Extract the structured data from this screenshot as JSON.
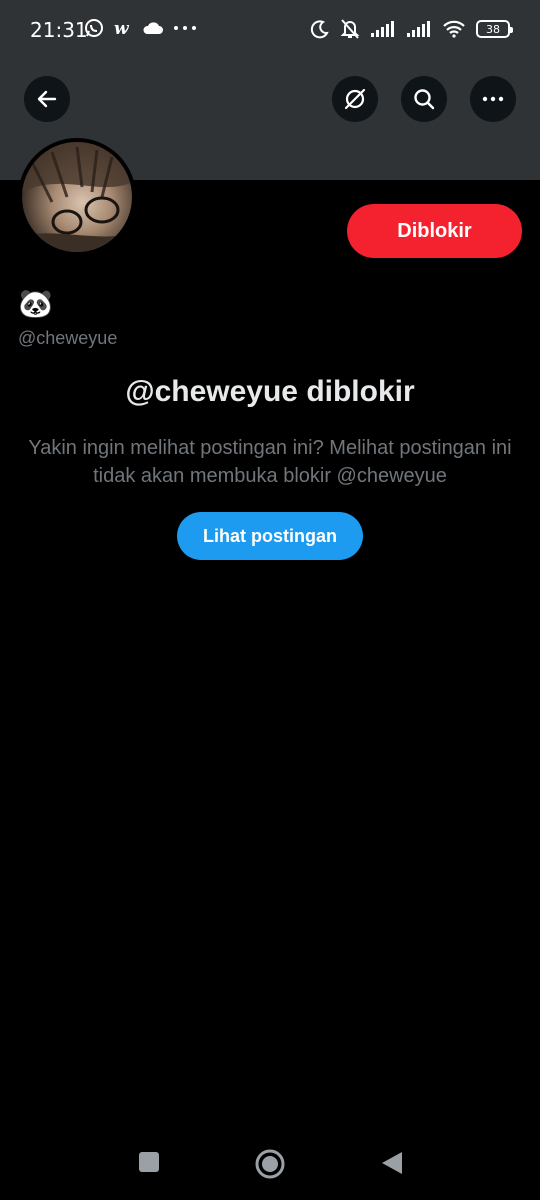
{
  "status_bar": {
    "time": "21:31",
    "battery": "38",
    "left_icons": [
      "whatsapp-icon",
      "webtoon-icon",
      "cloud-icon",
      "more-dots-icon"
    ],
    "right_icons": [
      "moon-icon",
      "bell-off-icon",
      "signal-icon",
      "signal-icon",
      "wifi-icon",
      "battery-icon"
    ]
  },
  "header": {
    "buttons": [
      "back-arrow-icon",
      "grok-icon",
      "search-icon",
      "more-horizontal-icon"
    ]
  },
  "profile": {
    "display_name": "🐼",
    "handle": "@cheweyue",
    "block_button_label": "Diblokir"
  },
  "blocked_notice": {
    "title": "@cheweyue diblokir",
    "description": "Yakin ingin melihat postingan ini? Melihat postingan ini tidak akan membuka blokir @cheweyue",
    "view_button_label": "Lihat postingan"
  },
  "colors": {
    "background": "#000000",
    "banner": "#2f3336",
    "blocked_red": "#f4212e",
    "primary_blue": "#1d9bf0",
    "secondary_text": "#71767b"
  },
  "nav_bar": {
    "buttons": [
      "recents-square-icon",
      "home-circle-icon",
      "back-triangle-icon"
    ]
  }
}
